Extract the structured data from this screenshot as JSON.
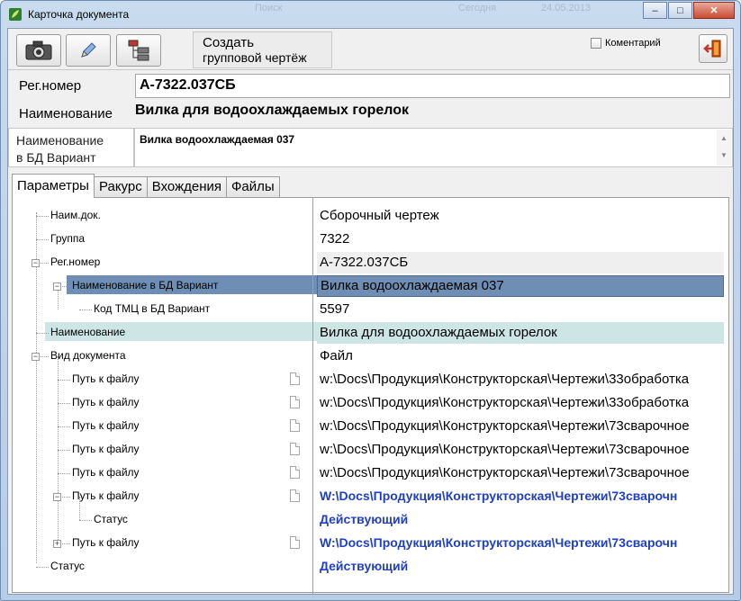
{
  "window": {
    "title": "Карточка документа",
    "ghost_texts": [
      "Поиск",
      "Сегодня",
      "24.05.2013"
    ],
    "buttons": {
      "minimize": "–",
      "maximize": "□",
      "close": "✕"
    }
  },
  "toolbar": {
    "camera_icon": "camera-icon",
    "edit_icon": "pencil-icon",
    "tree_icon": "tree-structure-icon",
    "create_group_line1": "Создать",
    "create_group_line2": "групповой чертёж",
    "comment_label": "Коментарий",
    "comment_checked": false,
    "exit_icon": "exit-door-icon"
  },
  "fields": {
    "reg_label": "Рег.номер",
    "reg_value": "А-7322.037СБ",
    "name_label": "Наименование",
    "name_value": "Вилка для водоохлаждаемых горелок",
    "bd_label_line1": "Наименование",
    "bd_label_line2": "в БД Вариант",
    "bd_value": "Вилка водоохлаждаемая 037"
  },
  "tabs": [
    "Параметры",
    "Ракурс",
    "Вхождения",
    "Файлы"
  ],
  "active_tab": "Параметры",
  "tree": [
    {
      "label": "Наим.док.",
      "value": "Сборочный чертеж"
    },
    {
      "label": "Группа",
      "value": "7322"
    },
    {
      "label": "Рег.номер",
      "value": "А-7322.037СБ"
    },
    {
      "label": "Наименование в БД Вариант",
      "value": "Вилка водоохлаждаемая 037"
    },
    {
      "label": "Код ТМЦ в БД Вариант",
      "value": "5597"
    },
    {
      "label": "Наименование",
      "value": "Вилка для водоохлаждаемых горелок"
    },
    {
      "label": "Вид документа",
      "value": "Файл"
    },
    {
      "label": "Путь к файлу",
      "value": "w:\\Docs\\Продукция\\Конструкторская\\Чертежи\\33обработка"
    },
    {
      "label": "Путь к файлу",
      "value": "w:\\Docs\\Продукция\\Конструкторская\\Чертежи\\33обработка"
    },
    {
      "label": "Путь к файлу",
      "value": "w:\\Docs\\Продукция\\Конструкторская\\Чертежи\\73сварочное"
    },
    {
      "label": "Путь к файлу",
      "value": "w:\\Docs\\Продукция\\Конструкторская\\Чертежи\\73сварочное"
    },
    {
      "label": "Путь к файлу",
      "value": "w:\\Docs\\Продукция\\Конструкторская\\Чертежи\\73сварочное"
    },
    {
      "label": "Путь к файлу",
      "value": "W:\\Docs\\Продукция\\Конструкторская\\Чертежи\\73сварочн"
    },
    {
      "label": "Статус",
      "value": "Действующий"
    },
    {
      "label": "Путь к файлу",
      "value": "W:\\Docs\\Продукция\\Конструкторская\\Чертежи\\73сварочн"
    },
    {
      "label": "Статус",
      "value": "Действующий"
    }
  ],
  "colors": {
    "selection_dark": "#6e8fb3",
    "selection_light": "#cde5e5",
    "link_blue": "#1f3fc4"
  }
}
